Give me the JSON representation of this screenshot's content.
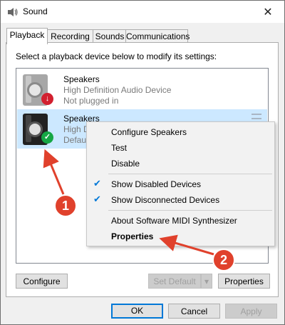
{
  "window": {
    "title": "Sound",
    "close_glyph": "✕"
  },
  "tabs": [
    "Playback",
    "Recording",
    "Sounds",
    "Communications"
  ],
  "instruction": "Select a playback device below to modify its settings:",
  "devices": [
    {
      "name": "Speakers",
      "line1": "High Definition Audio Device",
      "line2": "Not plugged in",
      "status_icon": "down-arrow-icon",
      "status_color": "#d2202f",
      "status_glyph": "↓"
    },
    {
      "name": "Speakers",
      "line1": "High D",
      "line2": "Defaul",
      "status_icon": "checkmark-icon",
      "status_color": "#15a745",
      "status_glyph": "✓"
    }
  ],
  "context_menu": {
    "items": [
      {
        "label": "Configure Speakers"
      },
      {
        "label": "Test"
      },
      {
        "label": "Disable"
      },
      {
        "label": "Show Disabled Devices",
        "checked": true
      },
      {
        "label": "Show Disconnected Devices",
        "checked": true
      },
      {
        "label": "About Software MIDI Synthesizer"
      },
      {
        "label": "Properties",
        "bold": true
      }
    ]
  },
  "panel_buttons": {
    "configure": "Configure",
    "set_default": "Set Default",
    "dropdown_glyph": "▾",
    "properties": "Properties"
  },
  "dialog_buttons": {
    "ok": "OK",
    "cancel": "Cancel",
    "apply": "Apply"
  },
  "annotations": [
    {
      "number": "1",
      "color": "#e0412c"
    },
    {
      "number": "2",
      "color": "#e0412c"
    }
  ],
  "colors": {
    "selection": "#cce8ff",
    "accent": "#0078d7",
    "annotation": "#e0412c"
  }
}
